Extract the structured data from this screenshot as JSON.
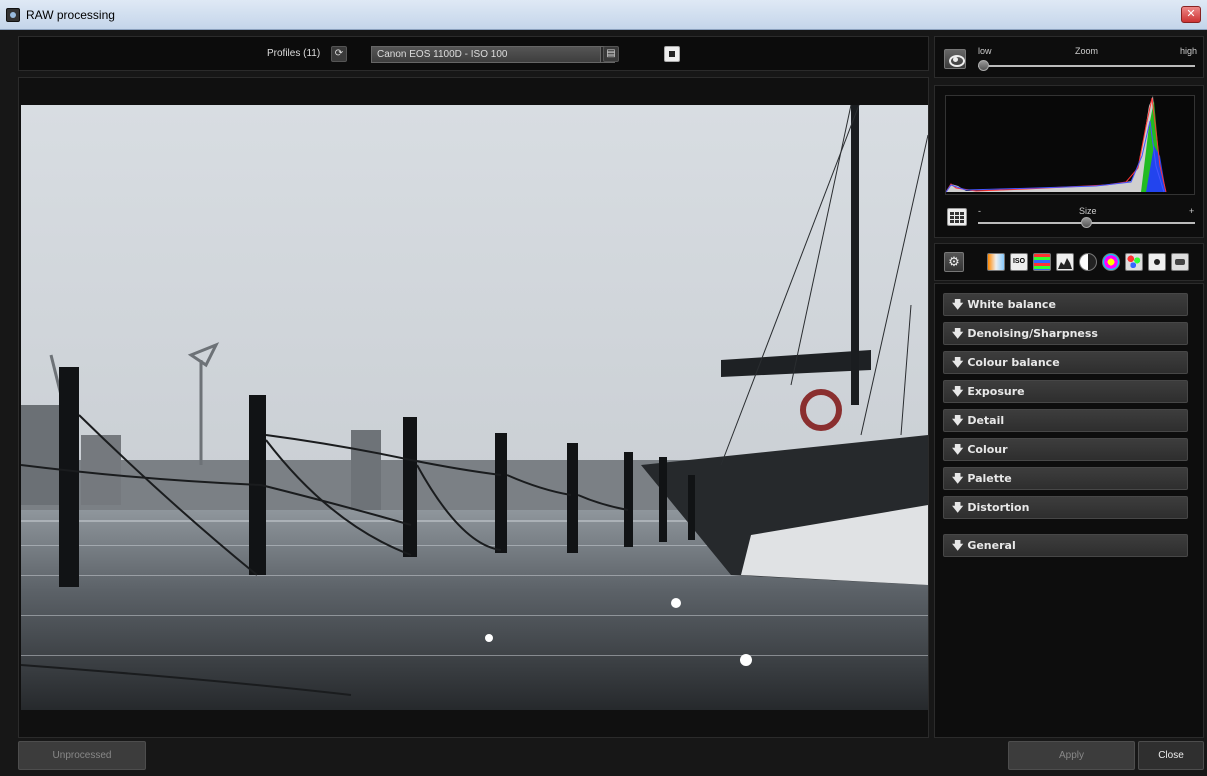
{
  "window": {
    "title": "RAW processing",
    "close_glyph": "✕"
  },
  "toolbar": {
    "profiles_label": "Profiles (11)",
    "profile_selected": "Canon EOS 1100D - ISO 100",
    "icons": [
      "refresh-icon",
      "dropdown-arrow-icon",
      "save-icon",
      "snapshot-icon"
    ]
  },
  "zoom": {
    "low_label": "low",
    "title": "Zoom",
    "high_label": "high",
    "level": 0.0
  },
  "histogram": {
    "size_label": "Size",
    "minus_label": "-",
    "plus_label": "+",
    "size_level": 0.5
  },
  "tool_icons": [
    "settings-icon",
    "white-balance-icon",
    "iso-icon",
    "color-lines-icon",
    "histogram-icon",
    "contrast-icon",
    "color-wheel-icon",
    "palette-icon",
    "camera-icon",
    "lens-icon"
  ],
  "settings": {
    "sections": [
      "White balance",
      "Denoising/Sharpness",
      "Colour balance",
      "Exposure",
      "Detail",
      "Colour",
      "Palette",
      "Distortion",
      "General"
    ]
  },
  "buttons": {
    "unprocessed": "Unprocessed",
    "apply": "Apply",
    "close": "Close"
  },
  "colors": {
    "accent_red": "#cc3333",
    "hist_green": "#33dd33",
    "hist_blue": "#3355ff",
    "hist_white": "#ffffff"
  }
}
